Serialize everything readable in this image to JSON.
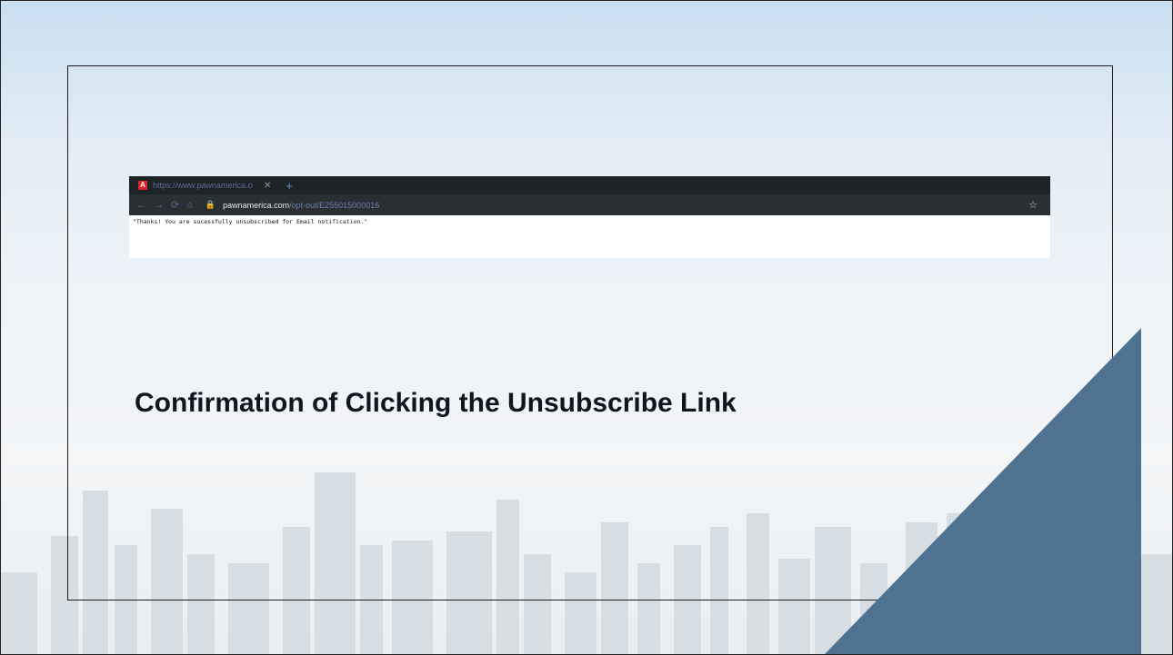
{
  "browser": {
    "tab_title": "https://www.pawnamerica.com",
    "tab_close": "✕",
    "new_tab": "+",
    "url_host": "pawnamerica.com",
    "url_path": "/opt-out/E255015000016",
    "page_message": "\"Thanks! You are sucessfully unsubscribed for Email notification.\""
  },
  "slide": {
    "title": "Confirmation of Clicking the Unsubscribe Link"
  },
  "colors": {
    "triangle": "#4f7290",
    "title_text": "#0f1620",
    "skyline": "#d4dbe1"
  }
}
